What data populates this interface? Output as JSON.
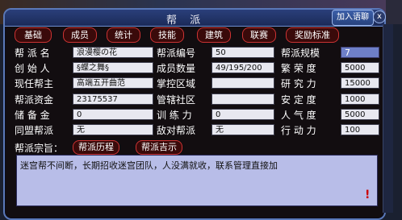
{
  "window": {
    "title": "帮 派",
    "join_label": "加入语聊",
    "close": "x"
  },
  "tabs": [
    "基础",
    "成员",
    "统计",
    "技能",
    "建筑",
    "联赛",
    "奖励标准"
  ],
  "left": [
    {
      "label": "帮 派 名",
      "value": "浪漫樱の花"
    },
    {
      "label": "创 始 人",
      "value": "§蝶之舞§"
    },
    {
      "label": "现任帮主",
      "value": "高端五开曲范"
    },
    {
      "label": "帮派资金",
      "value": "23175537"
    },
    {
      "label": "储 备 金",
      "value": "0"
    },
    {
      "label": "同盟帮派",
      "value": "无"
    }
  ],
  "middle": [
    {
      "label": "帮派编号",
      "value": "50"
    },
    {
      "label": "成员数量",
      "value": "49/195/200"
    },
    {
      "label": "掌控区域",
      "value": ""
    },
    {
      "label": "管辖社区",
      "value": ""
    },
    {
      "label": "训 练 力",
      "value": "0"
    },
    {
      "label": "敌对帮派",
      "value": "无"
    }
  ],
  "right": [
    {
      "label": "帮派规模",
      "value": "7"
    },
    {
      "label": "繁 荣 度",
      "value": "5000"
    },
    {
      "label": "研 究 力",
      "value": "15000"
    },
    {
      "label": "安 定 度",
      "value": "1000"
    },
    {
      "label": "人 气 度",
      "value": "5000"
    },
    {
      "label": "行 动 力",
      "value": "100"
    }
  ],
  "motto": {
    "label": "帮派宗旨：",
    "history_btn": "帮派历程",
    "notice_btn": "帮派吉示",
    "text": "迷宫帮不间断，长期招收迷宫团队，人没满就收，联系管理直接加"
  },
  "accent": "#cc3333"
}
